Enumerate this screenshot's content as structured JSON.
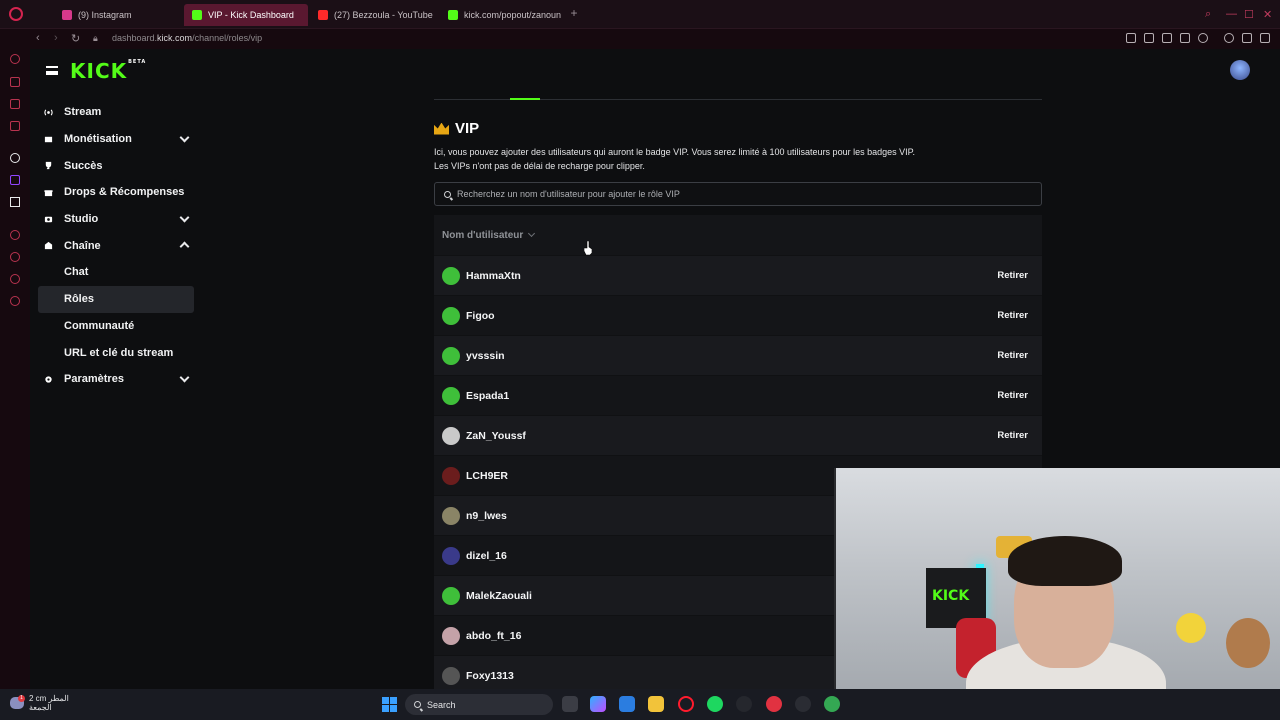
{
  "browser": {
    "tabs": [
      {
        "label": "(9) Instagram",
        "color": "#d6398b"
      },
      {
        "label": "VIP - Kick Dashboard",
        "color": "#53fc18",
        "active": true
      },
      {
        "label": "(27) Bezzoula - YouTube",
        "color": "#ff2a2a"
      },
      {
        "label": "kick.com/popout/zanoun",
        "color": "#53fc18"
      }
    ],
    "url_host": "dashboard.",
    "url_domain": "kick.com",
    "url_path": "/channel/roles/vip"
  },
  "app": {
    "logo": "KICK",
    "logo_badge": "BETA"
  },
  "sidebar": {
    "items": [
      {
        "label": "Stream"
      },
      {
        "label": "Monétisation"
      },
      {
        "label": "Succès"
      },
      {
        "label": "Drops & Récompenses"
      },
      {
        "label": "Studio"
      },
      {
        "label": "Chaîne"
      },
      {
        "label": "Chat"
      },
      {
        "label": "Rôles"
      },
      {
        "label": "Communauté"
      },
      {
        "label": "URL et clé du stream"
      },
      {
        "label": "Paramètres"
      }
    ]
  },
  "page": {
    "title": "VIP",
    "description_line1": "Ici, vous pouvez ajouter des utilisateurs qui auront le badge VIP. Vous serez limité à 100 utilisateurs pour les badges VIP.",
    "description_line2": "Les VIPs n'ont pas de délai de recharge pour clipper.",
    "search_placeholder": "Recherchez un nom d'utilisateur pour ajouter le rôle VIP",
    "column_header": "Nom d'utilisateur",
    "remove_label": "Retirer",
    "users": [
      {
        "name": "HammaXtn",
        "avatar_color": "#3fbf3a"
      },
      {
        "name": "Figoo",
        "avatar_color": "#3fbf3a"
      },
      {
        "name": "yvsssin",
        "avatar_color": "#3fbf3a"
      },
      {
        "name": "Espada1",
        "avatar_color": "#3fbf3a"
      },
      {
        "name": "ZaN_Youssf",
        "avatar_color": "#c9c9c9"
      },
      {
        "name": "LCH9ER",
        "avatar_color": "#6b1d1d"
      },
      {
        "name": "n9_lwes",
        "avatar_color": "#8a8466"
      },
      {
        "name": "dizel_16",
        "avatar_color": "#3a3a8a"
      },
      {
        "name": "MalekZaouali",
        "avatar_color": "#3fbf3a"
      },
      {
        "name": "abdo_ft_16",
        "avatar_color": "#c4a2a8"
      },
      {
        "name": "Foxy1313",
        "avatar_color": "#555555"
      }
    ]
  },
  "taskbar": {
    "weather_line1": "2 cm المطر",
    "weather_line2": "الجمعة",
    "weather_badge": "1",
    "search_label": "Search"
  },
  "colors": {
    "brand": "#53fc18",
    "accent_browser": "#d4244f"
  }
}
